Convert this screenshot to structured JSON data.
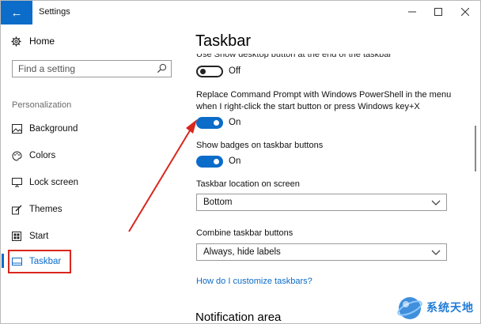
{
  "window": {
    "title": "Settings",
    "controls": [
      "minimize",
      "maximize",
      "close"
    ]
  },
  "sidebar": {
    "home_label": "Home",
    "search_placeholder": "Find a setting",
    "section_label": "Personalization",
    "items": [
      {
        "label": "Background",
        "icon": "picture-icon"
      },
      {
        "label": "Colors",
        "icon": "palette-icon"
      },
      {
        "label": "Lock screen",
        "icon": "monitor-icon"
      },
      {
        "label": "Themes",
        "icon": "brush-icon"
      },
      {
        "label": "Start",
        "icon": "start-grid-icon"
      },
      {
        "label": "Taskbar",
        "icon": "taskbar-icon",
        "selected": true
      }
    ]
  },
  "main": {
    "title": "Taskbar",
    "clipped_text": "Use Show desktop button at the end of the taskbar",
    "settings": [
      {
        "state_label": "Off",
        "on": false
      },
      {
        "label": "Replace Command Prompt with Windows PowerShell in the menu when I right-click the start button or press Windows key+X",
        "state_label": "On",
        "on": true
      },
      {
        "label": "Show badges on taskbar buttons",
        "state_label": "On",
        "on": true
      }
    ],
    "location": {
      "label": "Taskbar location on screen",
      "value": "Bottom"
    },
    "combine": {
      "label": "Combine taskbar buttons",
      "value": "Always, hide labels"
    },
    "help_link": "How do I customize taskbars?",
    "notification_title": "Notification area"
  },
  "watermark": {
    "text": "系统天地"
  },
  "colors": {
    "accent": "#0b6cc9",
    "annotation": "#d9261c"
  }
}
